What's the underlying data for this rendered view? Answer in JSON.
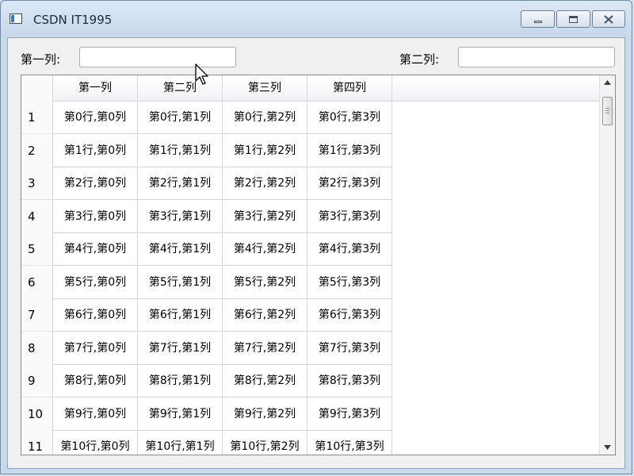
{
  "window": {
    "title": "CSDN IT1995"
  },
  "form": {
    "col1_label": "第一列:",
    "col1_value": "",
    "col2_label": "第二列:",
    "col2_value": ""
  },
  "table": {
    "headers": [
      "第一列",
      "第二列",
      "第三列",
      "第四列"
    ],
    "rows": [
      {
        "num": "1",
        "cells": [
          "第0行,第0列",
          "第0行,第1列",
          "第0行,第2列",
          "第0行,第3列"
        ]
      },
      {
        "num": "2",
        "cells": [
          "第1行,第0列",
          "第1行,第1列",
          "第1行,第2列",
          "第1行,第3列"
        ]
      },
      {
        "num": "3",
        "cells": [
          "第2行,第0列",
          "第2行,第1列",
          "第2行,第2列",
          "第2行,第3列"
        ]
      },
      {
        "num": "4",
        "cells": [
          "第3行,第0列",
          "第3行,第1列",
          "第3行,第2列",
          "第3行,第3列"
        ]
      },
      {
        "num": "5",
        "cells": [
          "第4行,第0列",
          "第4行,第1列",
          "第4行,第2列",
          "第4行,第3列"
        ]
      },
      {
        "num": "6",
        "cells": [
          "第5行,第0列",
          "第5行,第1列",
          "第5行,第2列",
          "第5行,第3列"
        ]
      },
      {
        "num": "7",
        "cells": [
          "第6行,第0列",
          "第6行,第1列",
          "第6行,第2列",
          "第6行,第3列"
        ]
      },
      {
        "num": "8",
        "cells": [
          "第7行,第0列",
          "第7行,第1列",
          "第7行,第2列",
          "第7行,第3列"
        ]
      },
      {
        "num": "9",
        "cells": [
          "第8行,第0列",
          "第8行,第1列",
          "第8行,第2列",
          "第8行,第3列"
        ]
      },
      {
        "num": "10",
        "cells": [
          "第9行,第0列",
          "第9行,第1列",
          "第9行,第2列",
          "第9行,第3列"
        ]
      },
      {
        "num": "11",
        "cells": [
          "第10行,第0列",
          "第10行,第1列",
          "第10行,第2列",
          "第10行,第3列"
        ]
      }
    ]
  },
  "icons": {
    "app": "window-app-icon",
    "minimize": "minimize-icon",
    "maximize": "maximize-icon",
    "close": "close-icon",
    "scroll_up": "scroll-up-arrow-icon",
    "scroll_down": "scroll-down-arrow-icon",
    "cursor": "mouse-pointer-icon"
  }
}
